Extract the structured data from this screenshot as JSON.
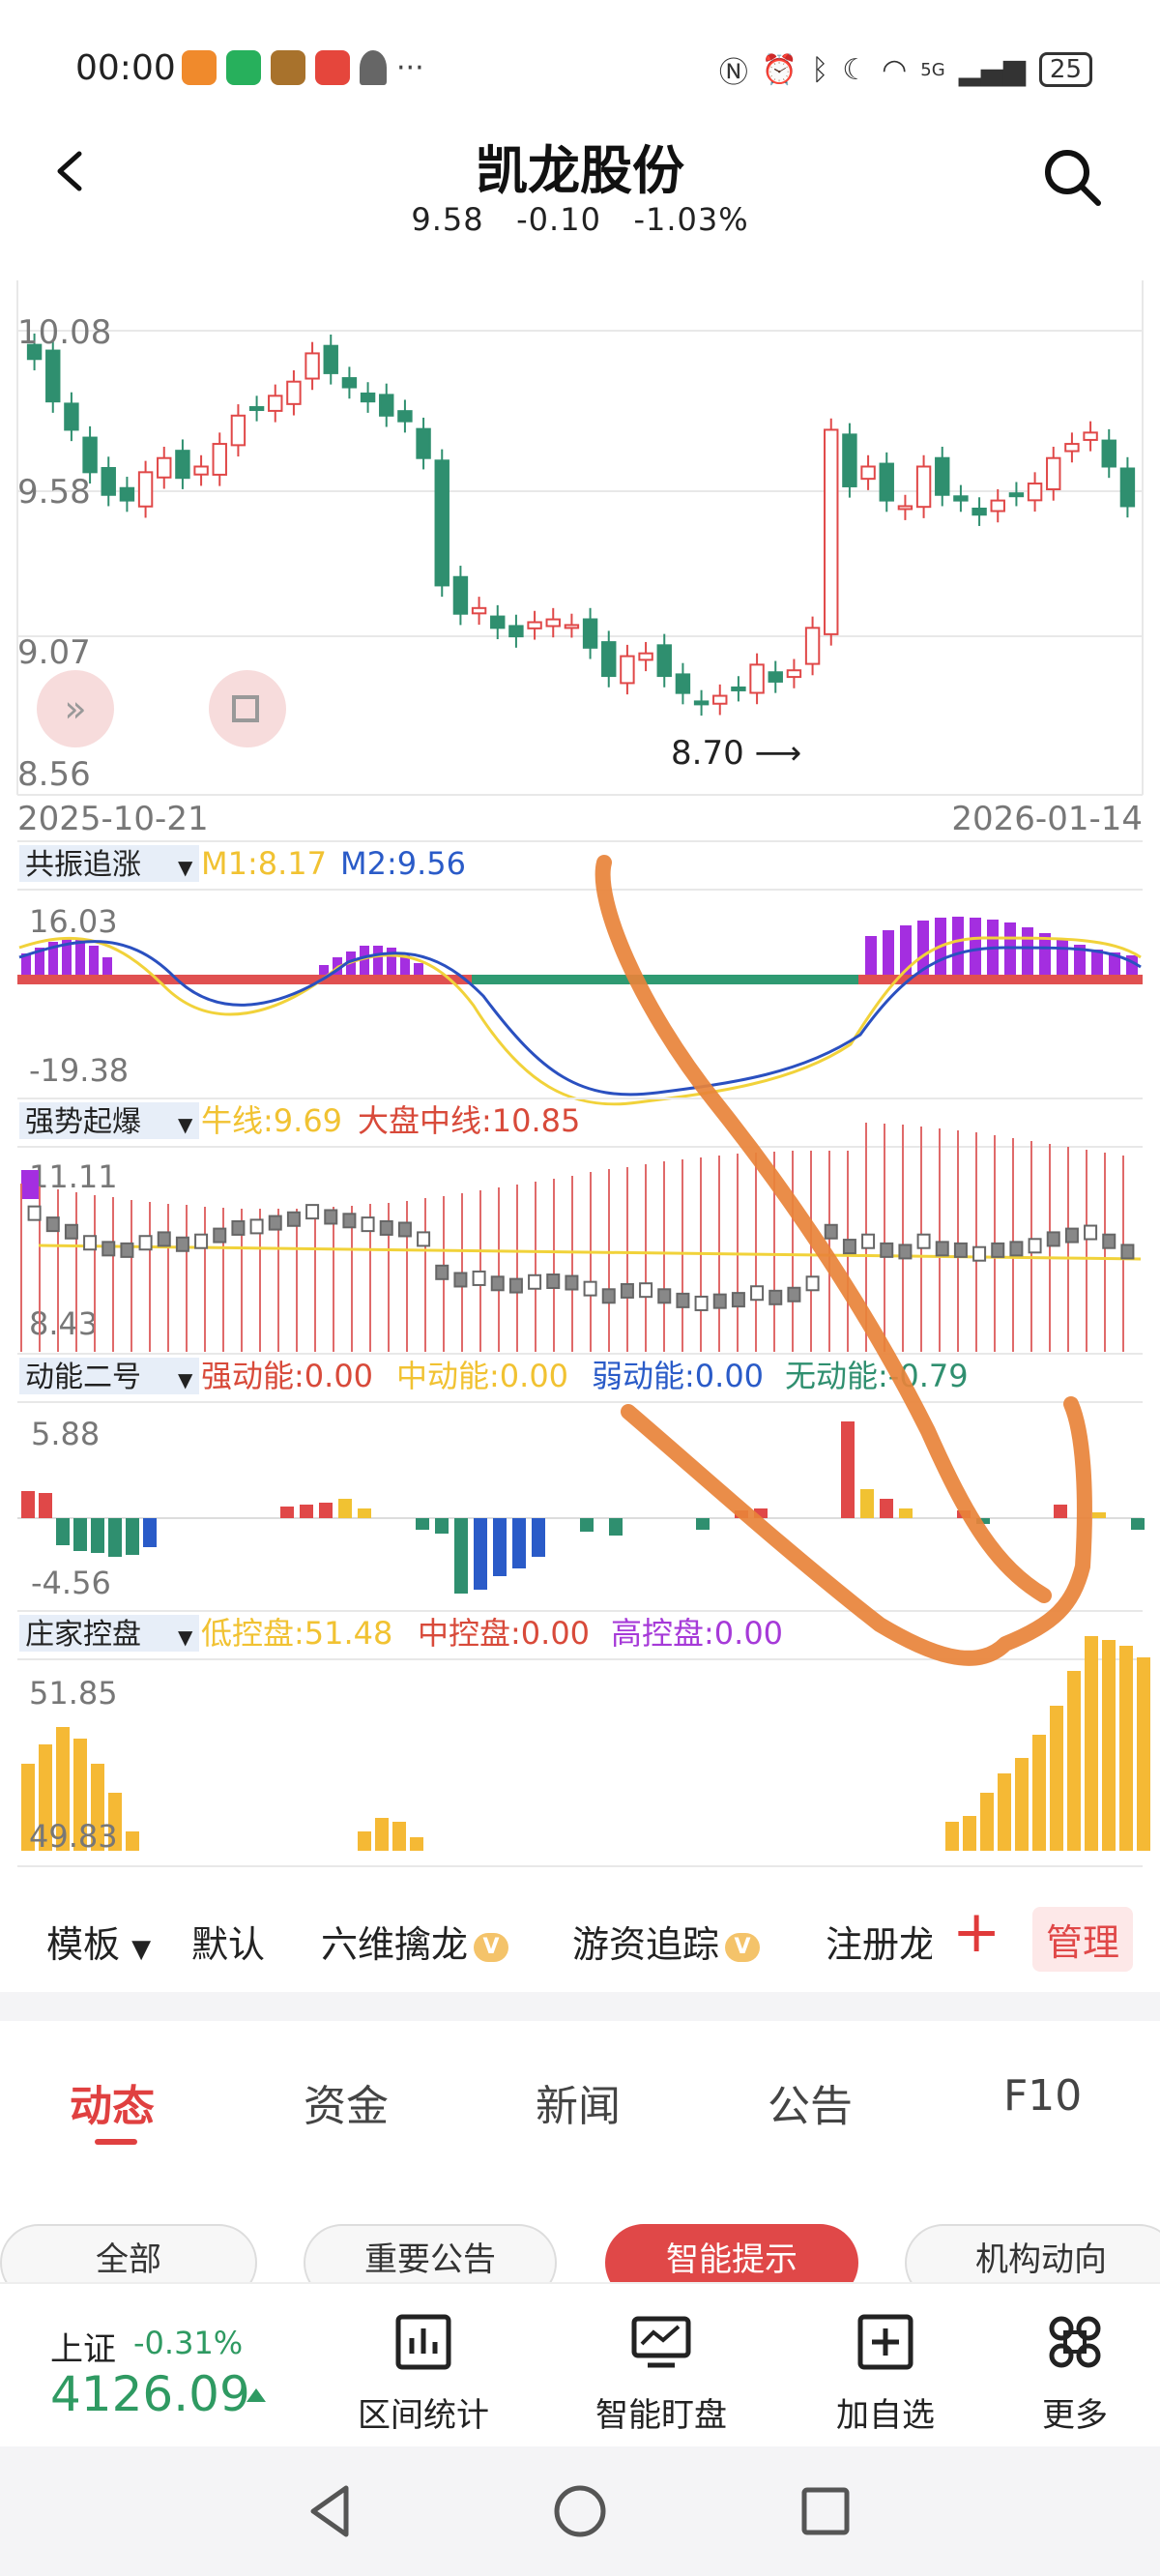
{
  "status_bar": {
    "time": "00:00",
    "battery": "25",
    "signal_label": "5G"
  },
  "header": {
    "title": "凯龙股份",
    "price": "9.58",
    "change": "-0.10",
    "change_pct": "-1.03%"
  },
  "main_chart": {
    "y_labels": [
      "10.08",
      "9.58",
      "9.07",
      "8.56"
    ],
    "date_start": "2025-10-21",
    "date_end": "2026-01-14",
    "low_marker": "8.70 ⟶"
  },
  "ind1": {
    "name": "共振追涨",
    "m1": "M1:8.17",
    "m2": "M2:9.56",
    "max": "16.03",
    "min": "-19.38"
  },
  "ind2": {
    "name": "强势起爆",
    "bull": "牛线:9.69",
    "mid": "大盘中线:10.85",
    "max": "11.11",
    "min": "8.43"
  },
  "ind3": {
    "name": "动能二号",
    "strong": "强动能:0.00",
    "medium": "中动能:0.00",
    "weak": "弱动能:0.00",
    "none": "无动能:-0.79",
    "max": "5.88",
    "min": "-4.56"
  },
  "ind4": {
    "name": "庄家控盘",
    "low": "低控盘:51.48",
    "mid": "中控盘:0.00",
    "high": "高控盘:0.00",
    "max": "51.85",
    "min": "49.83"
  },
  "template_bar": {
    "template_label": "模板",
    "items": [
      "默认",
      "六维擒龙",
      "游资追踪",
      "注册龙"
    ],
    "v_badge": "V",
    "manage": "管理"
  },
  "news_tabs": [
    "动态",
    "资金",
    "新闻",
    "公告",
    "F10"
  ],
  "chips": [
    "全部",
    "重要公告",
    "智能提示",
    "机构动向"
  ],
  "bottom": {
    "index_name": "上证",
    "index_change": "-0.31%",
    "index_value": "4126.09",
    "buttons": [
      "区间统计",
      "智能盯盘",
      "加自选",
      "更多"
    ]
  },
  "colors": {
    "up": "#e04848",
    "down": "#2f8f6f",
    "accent": "#e04040",
    "annotation": "#e8833a"
  }
}
